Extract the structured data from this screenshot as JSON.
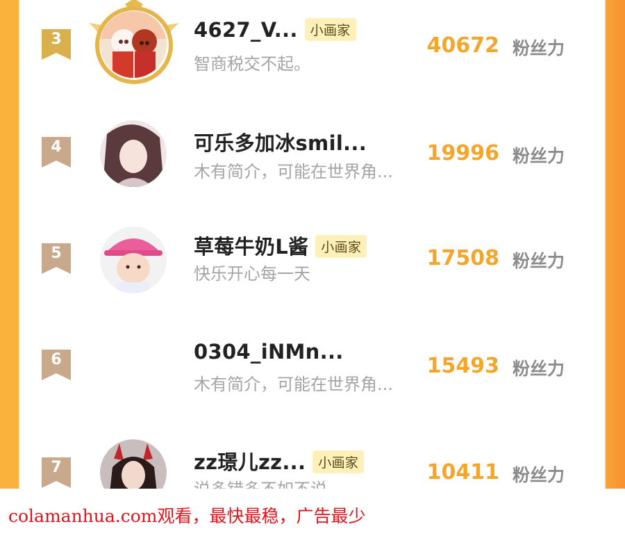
{
  "ranking": {
    "score_unit": "粉丝力",
    "badge_label": "小画家",
    "entries": [
      {
        "rank": "3",
        "name": "4627_V...",
        "bio": "智商税交不起。",
        "score": "40672",
        "badge": true,
        "avatar": "anime-couple-avatar",
        "has_crown": true
      },
      {
        "rank": "4",
        "name": "可乐多加冰smil...",
        "bio": "木有简介，可能在世界角...",
        "score": "19996",
        "badge": false,
        "avatar": "anime-girl-avatar"
      },
      {
        "rank": "5",
        "name": "草莓牛奶L酱",
        "bio": "快乐开心每一天",
        "score": "17508",
        "badge": true,
        "avatar": "baby-pink-hat-avatar"
      },
      {
        "rank": "6",
        "name": "0304_iNMn...",
        "bio": "木有简介，可能在世界角...",
        "score": "15493",
        "badge": false,
        "avatar": ""
      },
      {
        "rank": "7",
        "name": "zz璟儿zz...",
        "bio": "说多错多不如不说",
        "score": "10411",
        "badge": true,
        "avatar": "devil-horns-avatar"
      }
    ]
  },
  "footer": {
    "text": "colamanhua.com观看，最快最稳，广告最少"
  },
  "colors": {
    "score": "#f4a62b",
    "rank_gold": "#d9b04c",
    "rank_tan": "#c8a98b",
    "badge_bg": "#fdf0b8",
    "footer_text": "#e1121a"
  }
}
